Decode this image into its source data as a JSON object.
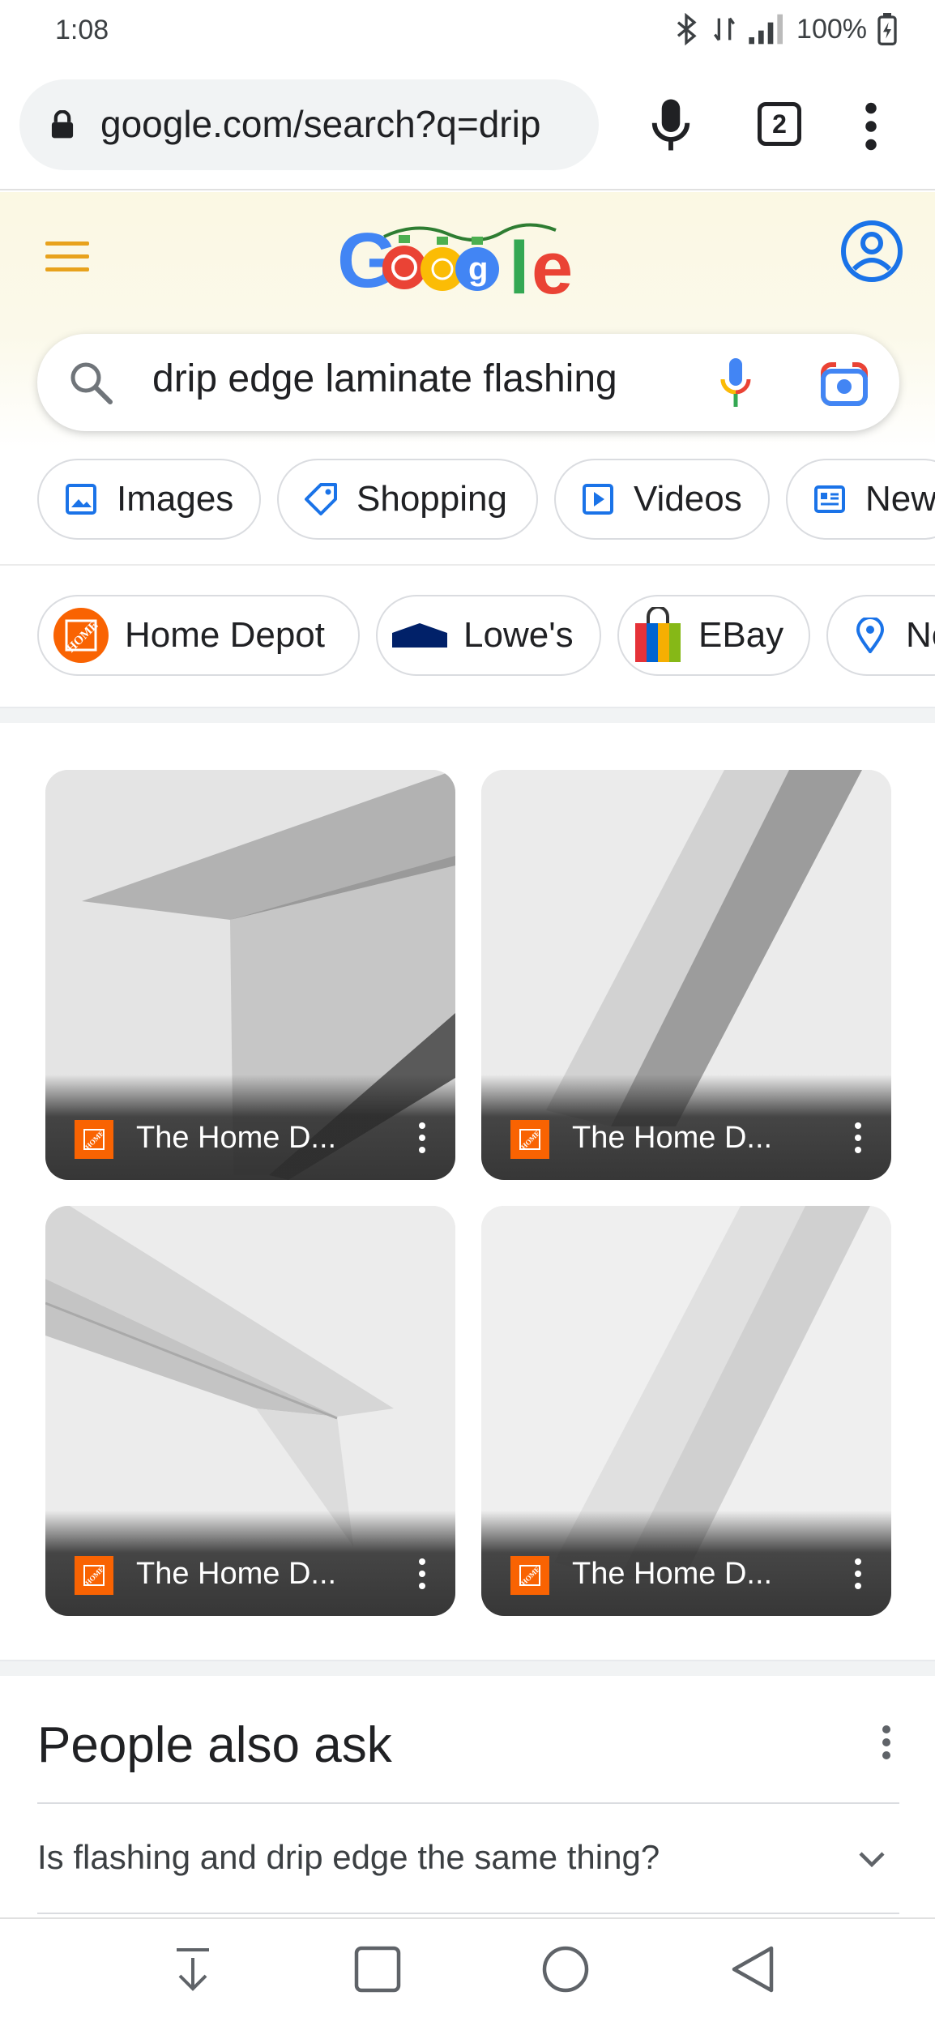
{
  "status_bar": {
    "time": "1:08",
    "battery": "100%"
  },
  "browser": {
    "url": "google.com/search?q=drip",
    "tab_count": "2"
  },
  "search": {
    "query": "drip edge laminate flashing"
  },
  "filter_chips": [
    {
      "label": "Images",
      "icon": "image-icon"
    },
    {
      "label": "Shopping",
      "icon": "tag-icon"
    },
    {
      "label": "Videos",
      "icon": "play-icon"
    },
    {
      "label": "New",
      "icon": "news-icon"
    }
  ],
  "store_chips": [
    {
      "label": "Home Depot",
      "icon": "home-depot-logo"
    },
    {
      "label": "Lowe's",
      "icon": "lowes-logo"
    },
    {
      "label": "EBay",
      "icon": "ebay-bag-icon"
    },
    {
      "label": "Ne",
      "icon": "location-pin-icon"
    }
  ],
  "image_results": [
    {
      "source": "The Home D..."
    },
    {
      "source": "The Home D..."
    },
    {
      "source": "The Home D..."
    },
    {
      "source": "The Home D..."
    }
  ],
  "people_also_ask": {
    "title": "People also ask",
    "questions": [
      "Is flashing and drip edge the same thing?"
    ]
  },
  "colors": {
    "google_blue": "#4285F4",
    "google_red": "#EA4335",
    "google_yellow": "#FBBC05",
    "google_green": "#34A853",
    "home_depot_orange": "#F96302",
    "header_bg": "#FBF8E3"
  }
}
